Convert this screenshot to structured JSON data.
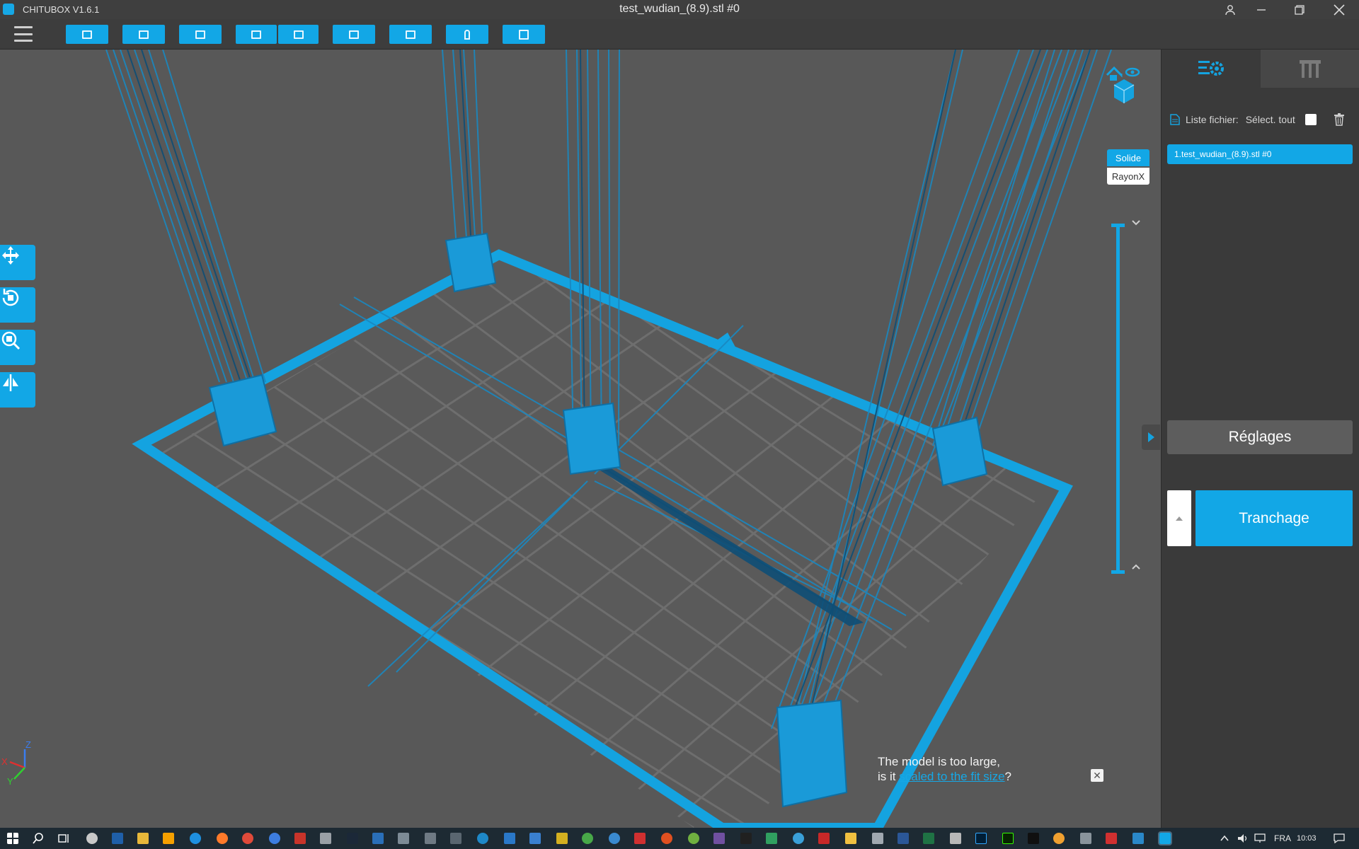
{
  "window": {
    "app_name": "CHITUBOX V1.6.1",
    "document_title": "test_wudian_(8.9).stl #0",
    "controls": [
      "account-icon",
      "minimize-icon",
      "restore-icon",
      "close-icon"
    ]
  },
  "toolbar": {
    "buttons": [
      "open-icon",
      "save-icon",
      "select-icon",
      "undo-icon",
      "redo-icon",
      "file-info-icon",
      "arrange-icon",
      "support-icon",
      "hollow-icon"
    ]
  },
  "left_tools": [
    "move-icon",
    "rotate-icon",
    "scale-icon",
    "mirror-icon"
  ],
  "view_mode": {
    "solid_label": "Solide",
    "xray_label": "RayonX",
    "active": "Solide"
  },
  "notification": {
    "line1": "The model is too large,",
    "line2_prefix": "is it ",
    "link_text": "scaled to the fit size",
    "line2_suffix": "?"
  },
  "axis": {
    "x": "X",
    "y": "Y",
    "z": "Z"
  },
  "right_panel": {
    "file_list_label": "Liste fichier:",
    "select_all_label": "Sélect. tout",
    "files": [
      "1.test_wudian_(8.9).stl #0"
    ],
    "settings_button": "Réglages",
    "slice_button": "Tranchage"
  },
  "taskbar": {
    "language": "FRA",
    "time": "10:03"
  },
  "colors": {
    "accent": "#12a7e6",
    "viewport_bg": "#585858",
    "panel_bg": "#3a3a3a"
  }
}
